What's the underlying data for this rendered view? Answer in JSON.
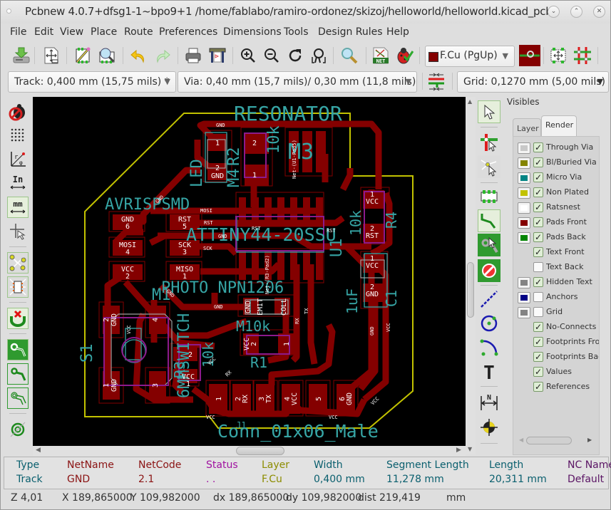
{
  "window": {
    "title": "Pcbnew 4.0.7+dfsg1-1~bpo9+1 /home/fablabo/ramiro-ordonez/skizoj/helloworld/helloworld.kicad_pcb",
    "controls": {
      "minimize": "⌄",
      "maximize": "⌃",
      "close": "✕"
    }
  },
  "menu": [
    "File",
    "Edit",
    "View",
    "Place",
    "Route",
    "Preferences",
    "Dimensions",
    "Tools",
    "Design Rules",
    "Help"
  ],
  "toolbar_top": {
    "icons": [
      "save-board-icon",
      "page-settings-icon",
      "footprint-editor-icon",
      "footprint-viewer-icon",
      "undo-icon",
      "redo-icon",
      "print-icon",
      "plot-icon",
      "zoom-in-icon",
      "zoom-out-icon",
      "redraw-icon",
      "zoom-fit-icon",
      "find-icon",
      "read-netlist-icon",
      "drc-icon",
      "layer-pair-icon",
      "autoplace-icon",
      "autoroute-icon"
    ],
    "layer_select": {
      "value": "F.Cu (PgUp)",
      "color": "#840000"
    }
  },
  "toolbar_options": {
    "track": "Track: 0,400 mm (15,75 mils) *",
    "via": "Via: 0,40 mm (15,7 mils)/ 0,30 mm (11,8 mils) *",
    "grid": "Grid: 0,1270 mm (5,00 mils)"
  },
  "left_toolbar": [
    "drc-off-icon",
    "grid-icon",
    "polar-coords-icon",
    "inch-units-icon",
    "mm-units-icon",
    "cursor-shape-icon",
    "ratsnest-icon",
    "module-ratsnest-icon",
    "auto-delete-track-icon",
    "zone-fill-icon",
    "zone-outline-icon",
    "zone-sketch-icon",
    "via-sketch-icon"
  ],
  "right_toolbar": [
    "select-icon",
    "highlight-net-icon",
    "local-ratsnest-icon",
    "add-footprint-icon",
    "route-track-icon",
    "add-zone-icon",
    "keepout-icon",
    "add-line-icon",
    "add-circle-icon",
    "add-arc-icon",
    "add-text-icon",
    "add-dimension-icon",
    "add-target-icon"
  ],
  "visibles": {
    "header": "Visibles",
    "tabs": [
      "Layer",
      "Render"
    ],
    "active_tab": "Render",
    "items": [
      {
        "label": "Through Via",
        "color": "#c8c8c8",
        "checked": true
      },
      {
        "label": "Bl/Buried Via",
        "color": "#848400",
        "checked": true
      },
      {
        "label": "Micro Via",
        "color": "#008484",
        "checked": true
      },
      {
        "label": "Non Plated",
        "color": "#c2c200",
        "checked": true
      },
      {
        "label": "Ratsnest",
        "color": "#ffffff",
        "checked": true
      },
      {
        "label": "Pads Front",
        "color": "#840000",
        "checked": true
      },
      {
        "label": "Pads Back",
        "color": "#008400",
        "checked": true
      },
      {
        "label": "Text Front",
        "color": null,
        "checked": true
      },
      {
        "label": "Text Back",
        "color": null,
        "checked": false
      },
      {
        "label": "Hidden Text",
        "color": "#848484",
        "checked": true
      },
      {
        "label": "Anchors",
        "color": "#000084",
        "checked": false
      },
      {
        "label": "Grid",
        "color": "#848484",
        "checked": false
      },
      {
        "label": "No-Connects",
        "color": null,
        "checked": true
      },
      {
        "label": "Footprints Front",
        "color": null,
        "checked": true
      },
      {
        "label": "Footprints Back",
        "color": null,
        "checked": true
      },
      {
        "label": "Values",
        "color": null,
        "checked": true
      },
      {
        "label": "References",
        "color": null,
        "checked": true
      }
    ]
  },
  "pcb": {
    "texts": {
      "resonator": "RESONATOR",
      "m3": "M3",
      "r2": "R2",
      "r2_val": "10k",
      "m4": "M4",
      "led": "LED",
      "avrisp": "AVRISPSMD",
      "attiny": "ATTINY44-20SSU",
      "u1": "U1",
      "r4": "R4",
      "r4_val": "10k",
      "c1": "C1",
      "c1_val": "1uF",
      "photo": "PHOTO NPN1206",
      "m1": "M1",
      "switch": "6MMSWITCH",
      "m2": "M2",
      "m10k": "M10k",
      "r3_val": "10k",
      "r3": "R3",
      "r1": "R1",
      "s1": "S1",
      "j1": "J1",
      "conn": "Conn_01x06_Male"
    },
    "pads": {
      "isp": [
        {
          "name": "GND",
          "num": "6"
        },
        {
          "name": "RST",
          "num": "5"
        },
        {
          "name": "MOSI",
          "num": "4"
        },
        {
          "name": "SCK",
          "num": "3"
        },
        {
          "name": "VCC",
          "num": "2"
        },
        {
          "name": "MISO",
          "num": "1"
        }
      ],
      "conn": [
        {
          "num": "1",
          "name": ""
        },
        {
          "num": "2",
          "name": "RX"
        },
        {
          "num": "3",
          "name": "TX"
        },
        {
          "num": "4",
          "name": "VCC"
        },
        {
          "num": "5",
          "name": ""
        },
        {
          "num": "6",
          "name": "GND"
        }
      ],
      "led": [
        "1",
        "2",
        "GND"
      ],
      "r2": [
        "2",
        "1"
      ],
      "r4": [
        "1",
        "VCC",
        "2",
        "RST"
      ],
      "c1": [
        "1",
        "VCC",
        "2",
        "GND"
      ],
      "photo": [
        "GND",
        "EMIT",
        "COLL"
      ],
      "r1": [
        "VCC",
        "2",
        "1"
      ],
      "r3": [
        "2",
        "VCC",
        "1"
      ],
      "switch": [
        "2",
        "GND",
        "4",
        "1",
        "GND",
        "3"
      ]
    },
    "netlabels": {
      "gnd": "GND",
      "mosi": "MOSI",
      "rst": "RST",
      "sck": "SCK",
      "vcc": "VCC",
      "rx": "RX",
      "tx": "TX",
      "pa5": "Net-(U1-Pad5)",
      "pad2": "Net-(R3-Pad2)"
    }
  },
  "message_panel": {
    "columns": [
      {
        "label": "Type",
        "value": "Track",
        "color": "#0a5f6e"
      },
      {
        "label": "NetName",
        "value": "GND",
        "color": "#8b1414"
      },
      {
        "label": "NetCode",
        "value": "2.1",
        "color": "#8b1414"
      },
      {
        "label": "Status",
        "value": ". .",
        "color": "#a012a0"
      },
      {
        "label": "Layer",
        "value": "F.Cu",
        "color": "#8c8c00"
      },
      {
        "label": "Width",
        "value": "0,400 mm",
        "color": "#0a5f6e"
      },
      {
        "label": "Segment Length",
        "value": "11,278 mm",
        "color": "#0a5f6e"
      },
      {
        "label": "Length",
        "value": "20,311 mm",
        "color": "#0a5f6e"
      },
      {
        "label": "NC Name",
        "value": "Default",
        "color": "#5a1464"
      }
    ]
  },
  "statusbar": {
    "zoom": "Z 4,01",
    "x": "X 189,865000",
    "y": "Y 109,982000",
    "dx": "dx 189,865000",
    "dy": "dy 109,982000",
    "dist": "dist 219,419",
    "units": "mm"
  }
}
